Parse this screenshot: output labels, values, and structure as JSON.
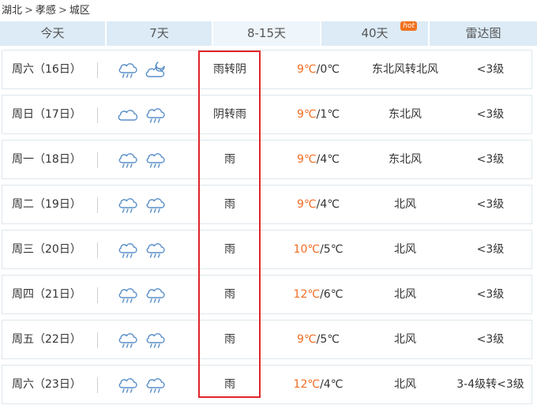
{
  "breadcrumb": [
    "湖北",
    "孝感",
    "城区"
  ],
  "tabs": [
    {
      "label": "今天",
      "active": false
    },
    {
      "label": "7天",
      "active": false
    },
    {
      "label": "8-15天",
      "active": true
    },
    {
      "label": "40天",
      "active": false,
      "badge": "hot"
    },
    {
      "label": "雷达图",
      "active": false
    }
  ],
  "forecast": [
    {
      "day": "周六（16日）",
      "icons": [
        "rain-cloud-icon",
        "cloudy-night-icon"
      ],
      "desc": "雨转阴",
      "high": "9℃",
      "low": "/0℃",
      "wind": "东北风转北风",
      "level": "<3级"
    },
    {
      "day": "周日（17日）",
      "icons": [
        "cloud-icon",
        "rain-cloud-icon"
      ],
      "desc": "阴转雨",
      "high": "9℃",
      "low": "/1℃",
      "wind": "东北风",
      "level": "<3级"
    },
    {
      "day": "周一（18日）",
      "icons": [
        "rain-cloud-icon",
        "rain-cloud-icon"
      ],
      "desc": "雨",
      "high": "9℃",
      "low": "/4℃",
      "wind": "东北风",
      "level": "<3级"
    },
    {
      "day": "周二（19日）",
      "icons": [
        "rain-cloud-icon",
        "rain-cloud-icon"
      ],
      "desc": "雨",
      "high": "9℃",
      "low": "/4℃",
      "wind": "北风",
      "level": "<3级"
    },
    {
      "day": "周三（20日）",
      "icons": [
        "rain-cloud-icon",
        "rain-cloud-icon"
      ],
      "desc": "雨",
      "high": "10℃",
      "low": "/5℃",
      "wind": "北风",
      "level": "<3级"
    },
    {
      "day": "周四（21日）",
      "icons": [
        "rain-cloud-icon",
        "rain-cloud-icon"
      ],
      "desc": "雨",
      "high": "12℃",
      "low": "/6℃",
      "wind": "北风",
      "level": "<3级"
    },
    {
      "day": "周五（22日）",
      "icons": [
        "rain-cloud-icon",
        "rain-cloud-icon"
      ],
      "desc": "雨",
      "high": "9℃",
      "low": "/5℃",
      "wind": "北风",
      "level": "<3级"
    },
    {
      "day": "周六（23日）",
      "icons": [
        "rain-cloud-icon",
        "rain-cloud-icon"
      ],
      "desc": "雨",
      "high": "12℃",
      "low": "/4℃",
      "wind": "北风",
      "level": "3-4级转<3级"
    }
  ],
  "colors": {
    "accent_temp": "#f26b22",
    "icon_stroke": "#5a8fc8",
    "highlight": "#e0252b",
    "tab_bg": "#dcebf6"
  }
}
